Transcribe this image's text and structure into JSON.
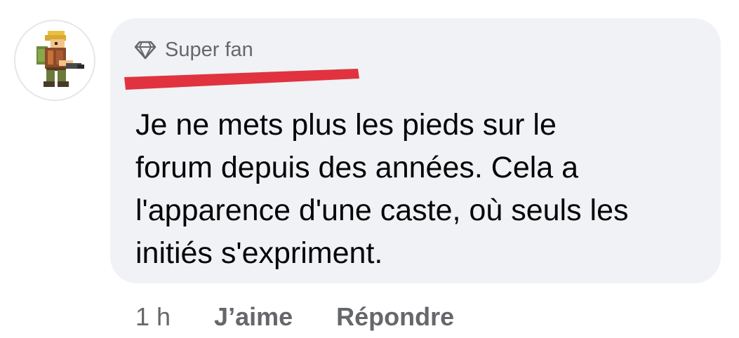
{
  "comment": {
    "author_badge": "Super fan",
    "author_name_redacted": true,
    "text": "Je ne mets plus les pieds sur le\nforum depuis des années. Cela a\nl'apparence d'une caste, où seuls les\ninitiés s'expriment.",
    "timestamp": "1 h",
    "actions": {
      "like_label": "J’aime",
      "reply_label": "Répondre"
    }
  },
  "icons": {
    "badge": "diamond-icon",
    "avatar": "pixel-soldier-avatar"
  },
  "colors": {
    "bubble_bg": "#f0f2f5",
    "secondary_text": "#65676b",
    "primary_text": "#050505",
    "redaction": "#e0333f"
  }
}
